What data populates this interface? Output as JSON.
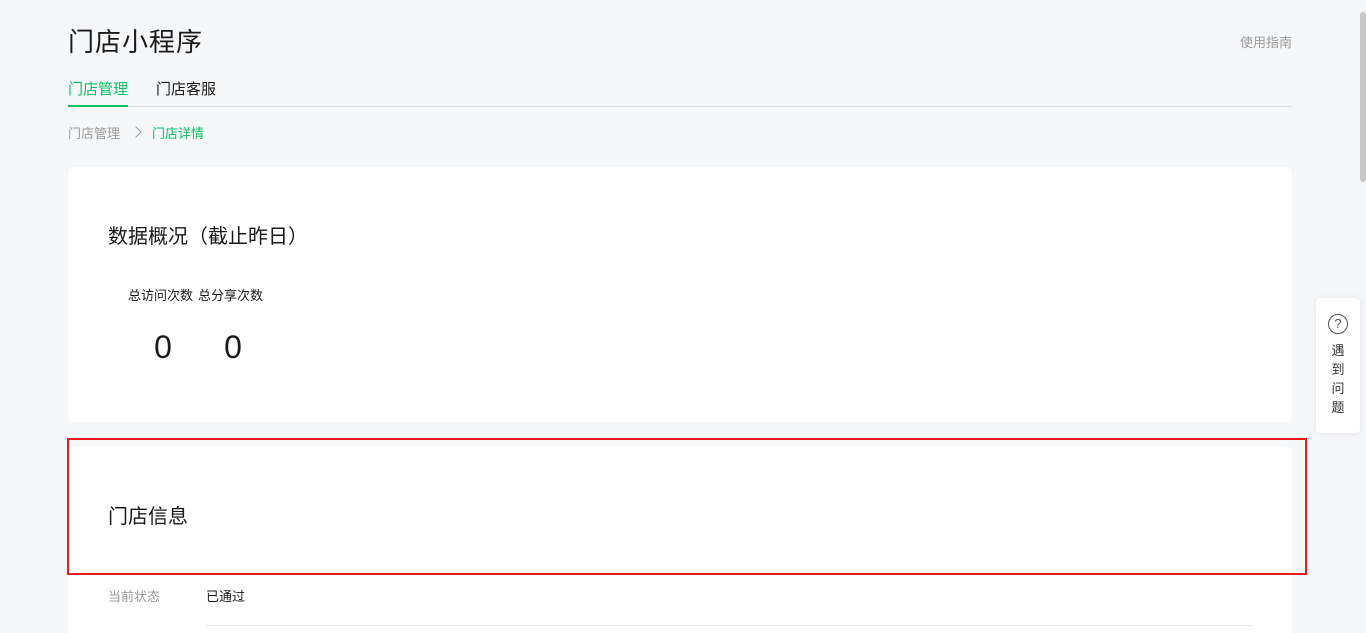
{
  "header": {
    "title": "门店小程序",
    "guide_link": "使用指南"
  },
  "tabs": [
    {
      "label": "门店管理",
      "active": true
    },
    {
      "label": "门店客服",
      "active": false
    }
  ],
  "breadcrumb": {
    "parent": "门店管理",
    "current": "门店详情"
  },
  "stats_card": {
    "title": "数据概况（截止昨日）",
    "items": [
      {
        "label": "总访问次数",
        "value": "0"
      },
      {
        "label": "总分享次数",
        "value": "0"
      }
    ]
  },
  "info_card": {
    "title": "门店信息",
    "fields": [
      {
        "label": "当前状态",
        "value": "已通过"
      }
    ]
  },
  "help_widget": {
    "icon": "question-circle-icon",
    "icon_glyph": "?",
    "label": "遇到问题"
  },
  "colors": {
    "accent": "#07c160",
    "highlight": "#e81c1c",
    "background": "#f6f7f9"
  }
}
